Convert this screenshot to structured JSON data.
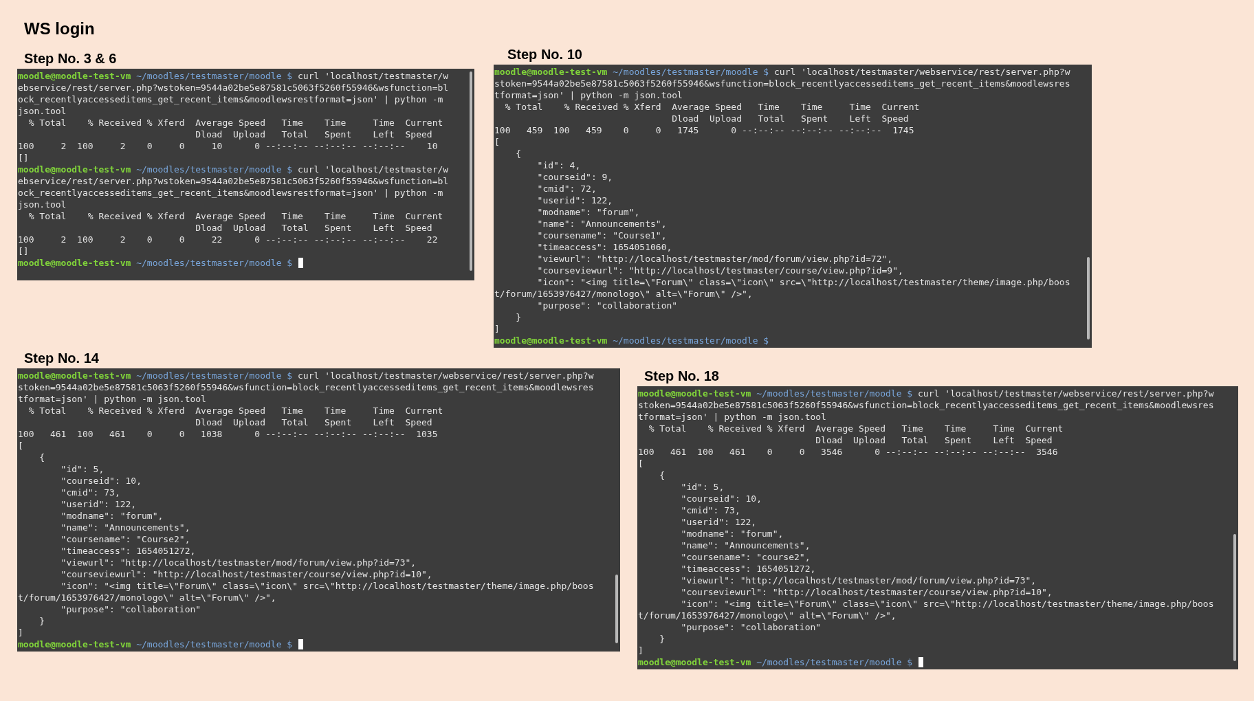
{
  "title": "WS login",
  "panels": [
    {
      "heading": "Step No. 3 & 6",
      "cursor_visible": true,
      "lines": [
        {
          "kind": "prompt",
          "user": "moodle@moodle-test-vm",
          "path": "~/moodles/testmaster/moodle",
          "sign": "$",
          "command": "curl 'localhost/testmaster/w"
        },
        {
          "kind": "text",
          "text": "ebservice/rest/server.php?wstoken=9544a02be5e87581c5063f5260f55946&wsfunction=bl"
        },
        {
          "kind": "text",
          "text": "ock_recentlyaccesseditems_get_recent_items&moodlewsrestformat=json' | python -m"
        },
        {
          "kind": "text",
          "text": "json.tool"
        },
        {
          "kind": "text",
          "text": "  % Total    % Received % Xferd  Average Speed   Time    Time     Time  Current"
        },
        {
          "kind": "text",
          "text": "                                 Dload  Upload   Total   Spent    Left  Speed"
        },
        {
          "kind": "text",
          "text": "100     2  100     2    0     0     10      0 --:--:-- --:--:-- --:--:--    10"
        },
        {
          "kind": "text",
          "text": "[]"
        },
        {
          "kind": "prompt",
          "user": "moodle@moodle-test-vm",
          "path": "~/moodles/testmaster/moodle",
          "sign": "$",
          "command": "curl 'localhost/testmaster/w"
        },
        {
          "kind": "text",
          "text": "ebservice/rest/server.php?wstoken=9544a02be5e87581c5063f5260f55946&wsfunction=bl"
        },
        {
          "kind": "text",
          "text": "ock_recentlyaccesseditems_get_recent_items&moodlewsrestformat=json' | python -m"
        },
        {
          "kind": "text",
          "text": "json.tool"
        },
        {
          "kind": "text",
          "text": "  % Total    % Received % Xferd  Average Speed   Time    Time     Time  Current"
        },
        {
          "kind": "text",
          "text": "                                 Dload  Upload   Total   Spent    Left  Speed"
        },
        {
          "kind": "text",
          "text": "100     2  100     2    0     0     22      0 --:--:-- --:--:-- --:--:--    22"
        },
        {
          "kind": "text",
          "text": "[]"
        },
        {
          "kind": "prompt",
          "user": "moodle@moodle-test-vm",
          "path": "~/moodles/testmaster/moodle",
          "sign": "$"
        }
      ]
    },
    {
      "heading": "Step No. 10",
      "cursor_visible": false,
      "lines": [
        {
          "kind": "prompt",
          "user": "moodle@moodle-test-vm",
          "path": "~/moodles/testmaster/moodle",
          "sign": "$",
          "command": "curl 'localhost/testmaster/webservice/rest/server.php?w"
        },
        {
          "kind": "text",
          "text": "stoken=9544a02be5e87581c5063f5260f55946&wsfunction=block_recentlyaccesseditems_get_recent_items&moodlewsres"
        },
        {
          "kind": "text",
          "text": "tformat=json' | python -m json.tool"
        },
        {
          "kind": "text",
          "text": "  % Total    % Received % Xferd  Average Speed   Time    Time     Time  Current"
        },
        {
          "kind": "text",
          "text": "                                 Dload  Upload   Total   Spent    Left  Speed"
        },
        {
          "kind": "text",
          "text": "100   459  100   459    0     0   1745      0 --:--:-- --:--:-- --:--:--  1745"
        },
        {
          "kind": "text",
          "text": "["
        },
        {
          "kind": "text",
          "text": "    {"
        },
        {
          "kind": "text",
          "text": "        \"id\": 4,"
        },
        {
          "kind": "text",
          "text": "        \"courseid\": 9,"
        },
        {
          "kind": "text",
          "text": "        \"cmid\": 72,"
        },
        {
          "kind": "text",
          "text": "        \"userid\": 122,"
        },
        {
          "kind": "text",
          "text": "        \"modname\": \"forum\","
        },
        {
          "kind": "text",
          "text": "        \"name\": \"Announcements\","
        },
        {
          "kind": "text",
          "text": "        \"coursename\": \"Course1\","
        },
        {
          "kind": "text",
          "text": "        \"timeaccess\": 1654051060,"
        },
        {
          "kind": "text",
          "text": "        \"viewurl\": \"http://localhost/testmaster/mod/forum/view.php?id=72\","
        },
        {
          "kind": "text",
          "text": "        \"courseviewurl\": \"http://localhost/testmaster/course/view.php?id=9\","
        },
        {
          "kind": "text",
          "text": "        \"icon\": \"<img title=\\\"Forum\\\" class=\\\"icon\\\" src=\\\"http://localhost/testmaster/theme/image.php/boos"
        },
        {
          "kind": "text",
          "text": "t/forum/1653976427/monologo\\\" alt=\\\"Forum\\\" />\","
        },
        {
          "kind": "text",
          "text": "        \"purpose\": \"collaboration\""
        },
        {
          "kind": "text",
          "text": "    }"
        },
        {
          "kind": "text",
          "text": "]"
        },
        {
          "kind": "prompt",
          "user": "moodle@moodle-test-vm",
          "path": "~/moodles/testmaster/moodle",
          "sign": "$"
        }
      ]
    },
    {
      "heading": "Step No. 14",
      "cursor_visible": true,
      "lines": [
        {
          "kind": "prompt",
          "user": "moodle@moodle-test-vm",
          "path": "~/moodles/testmaster/moodle",
          "sign": "$",
          "command": "curl 'localhost/testmaster/webservice/rest/server.php?w"
        },
        {
          "kind": "text",
          "text": "stoken=9544a02be5e87581c5063f5260f55946&wsfunction=block_recentlyaccesseditems_get_recent_items&moodlewsres"
        },
        {
          "kind": "text",
          "text": "tformat=json' | python -m json.tool"
        },
        {
          "kind": "text",
          "text": "  % Total    % Received % Xferd  Average Speed   Time    Time     Time  Current"
        },
        {
          "kind": "text",
          "text": "                                 Dload  Upload   Total   Spent    Left  Speed"
        },
        {
          "kind": "text",
          "text": "100   461  100   461    0     0   1038      0 --:--:-- --:--:-- --:--:--  1035"
        },
        {
          "kind": "text",
          "text": "["
        },
        {
          "kind": "text",
          "text": "    {"
        },
        {
          "kind": "text",
          "text": "        \"id\": 5,"
        },
        {
          "kind": "text",
          "text": "        \"courseid\": 10,"
        },
        {
          "kind": "text",
          "text": "        \"cmid\": 73,"
        },
        {
          "kind": "text",
          "text": "        \"userid\": 122,"
        },
        {
          "kind": "text",
          "text": "        \"modname\": \"forum\","
        },
        {
          "kind": "text",
          "text": "        \"name\": \"Announcements\","
        },
        {
          "kind": "text",
          "text": "        \"coursename\": \"Course2\","
        },
        {
          "kind": "text",
          "text": "        \"timeaccess\": 1654051272,"
        },
        {
          "kind": "text",
          "text": "        \"viewurl\": \"http://localhost/testmaster/mod/forum/view.php?id=73\","
        },
        {
          "kind": "text",
          "text": "        \"courseviewurl\": \"http://localhost/testmaster/course/view.php?id=10\","
        },
        {
          "kind": "text",
          "text": "        \"icon\": \"<img title=\\\"Forum\\\" class=\\\"icon\\\" src=\\\"http://localhost/testmaster/theme/image.php/boos"
        },
        {
          "kind": "text",
          "text": "t/forum/1653976427/monologo\\\" alt=\\\"Forum\\\" />\","
        },
        {
          "kind": "text",
          "text": "        \"purpose\": \"collaboration\""
        },
        {
          "kind": "text",
          "text": "    }"
        },
        {
          "kind": "text",
          "text": "]"
        },
        {
          "kind": "prompt",
          "user": "moodle@moodle-test-vm",
          "path": "~/moodles/testmaster/moodle",
          "sign": "$"
        }
      ]
    },
    {
      "heading": "Step No. 18",
      "cursor_visible": true,
      "lines": [
        {
          "kind": "prompt",
          "user": "moodle@moodle-test-vm",
          "path": "~/moodles/testmaster/moodle",
          "sign": "$",
          "command": "curl 'localhost/testmaster/webservice/rest/server.php?w"
        },
        {
          "kind": "text",
          "text": "stoken=9544a02be5e87581c5063f5260f55946&wsfunction=block_recentlyaccesseditems_get_recent_items&moodlewsres"
        },
        {
          "kind": "text",
          "text": "tformat=json' | python -m json.tool"
        },
        {
          "kind": "text",
          "text": "  % Total    % Received % Xferd  Average Speed   Time    Time     Time  Current"
        },
        {
          "kind": "text",
          "text": "                                 Dload  Upload   Total   Spent    Left  Speed"
        },
        {
          "kind": "text",
          "text": "100   461  100   461    0     0   3546      0 --:--:-- --:--:-- --:--:--  3546"
        },
        {
          "kind": "text",
          "text": "["
        },
        {
          "kind": "text",
          "text": "    {"
        },
        {
          "kind": "text",
          "text": "        \"id\": 5,"
        },
        {
          "kind": "text",
          "text": "        \"courseid\": 10,"
        },
        {
          "kind": "text",
          "text": "        \"cmid\": 73,"
        },
        {
          "kind": "text",
          "text": "        \"userid\": 122,"
        },
        {
          "kind": "text",
          "text": "        \"modname\": \"forum\","
        },
        {
          "kind": "text",
          "text": "        \"name\": \"Announcements\","
        },
        {
          "kind": "text",
          "text": "        \"coursename\": \"course2\","
        },
        {
          "kind": "text",
          "text": "        \"timeaccess\": 1654051272,"
        },
        {
          "kind": "text",
          "text": "        \"viewurl\": \"http://localhost/testmaster/mod/forum/view.php?id=73\","
        },
        {
          "kind": "text",
          "text": "        \"courseviewurl\": \"http://localhost/testmaster/course/view.php?id=10\","
        },
        {
          "kind": "text",
          "text": "        \"icon\": \"<img title=\\\"Forum\\\" class=\\\"icon\\\" src=\\\"http://localhost/testmaster/theme/image.php/boos"
        },
        {
          "kind": "text",
          "text": "t/forum/1653976427/monologo\\\" alt=\\\"Forum\\\" />\","
        },
        {
          "kind": "text",
          "text": "        \"purpose\": \"collaboration\""
        },
        {
          "kind": "text",
          "text": "    }"
        },
        {
          "kind": "text",
          "text": "]"
        },
        {
          "kind": "prompt",
          "user": "moodle@moodle-test-vm",
          "path": "~/moodles/testmaster/moodle",
          "sign": "$"
        }
      ]
    }
  ]
}
